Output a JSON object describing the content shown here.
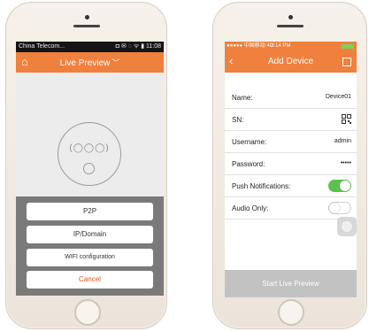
{
  "left": {
    "status": {
      "carrier": "China Telecom...",
      "icons": "◘ ✉  ◌ ᯤ ▮ 11:08"
    },
    "header": {
      "home_icon": "home-icon",
      "title": "Live Preview",
      "chevron": "﹀"
    },
    "camera": {
      "lens_row": "(◯◯◯)"
    },
    "sheet": {
      "options": [
        "P2P",
        "IP/Domain",
        "WIFI configuration"
      ],
      "cancel": "Cancel",
      "cancel_color": "#e55020"
    }
  },
  "right": {
    "status": {
      "carrier": "●●●●● 中国移动 4G",
      "time": "3:14 PM"
    },
    "header": {
      "back": "‹",
      "title": "Add Device"
    },
    "form": {
      "name_label": "Name:",
      "name_value": "Device01",
      "sn_label": "SN:",
      "username_label": "Username:",
      "username_value": "admin",
      "password_label": "Password:",
      "password_value": "•••••",
      "push_label": "Push Notifications:",
      "push_on": true,
      "audio_label": "Audio Only:",
      "audio_on": false
    },
    "start_button": "Start Live Preview"
  },
  "colors": {
    "accent": "#f0803d",
    "toggle_on": "#5ac14c",
    "start_button": "#c2c2c2"
  }
}
